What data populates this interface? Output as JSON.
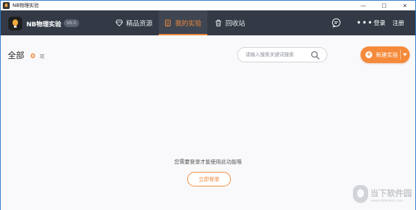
{
  "window": {
    "title": "NB物理实验",
    "controls": {
      "minimize": "—",
      "maximize": "☐",
      "close": "✕"
    }
  },
  "nav": {
    "brand": "NB物理实验",
    "version": "V6.0",
    "items": [
      {
        "label": "精品资源",
        "icon": "diamond-icon",
        "active": false
      },
      {
        "label": "我的实验",
        "icon": "clipboard-icon",
        "active": true
      },
      {
        "label": "回收站",
        "icon": "trash-icon",
        "active": false
      }
    ],
    "chat_icon": "chat-bubble-icon",
    "more": "•••",
    "login": "登录",
    "register": "注册"
  },
  "main": {
    "heading": "全部",
    "count": "0",
    "count_unit": "项",
    "search": {
      "placeholder": "请输入搜索关键词搜索",
      "icon": "search-icon"
    },
    "new_button": {
      "label": "新建实验",
      "icon": "plus-icon",
      "dropdown_icon": "caret-down-icon"
    },
    "notice": "您需要登录才能使用此功能哦",
    "login_button": "立即登录"
  },
  "watermark": {
    "text": "当下软件园",
    "url": "www.downxia.com"
  },
  "colors": {
    "accent": "#f08a3c",
    "navbar": "#333a45",
    "background": "#f9f9fb"
  }
}
